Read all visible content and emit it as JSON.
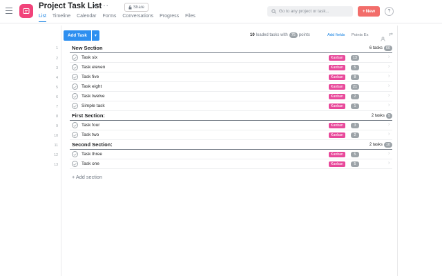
{
  "header": {
    "project_title": "Project Task List",
    "more": "···",
    "share_label": "Share",
    "tabs": [
      {
        "label": "List",
        "active": true
      },
      {
        "label": "Timeline"
      },
      {
        "label": "Calendar"
      },
      {
        "label": "Forms"
      },
      {
        "label": "Conversations"
      },
      {
        "label": "Progress"
      },
      {
        "label": "Files"
      }
    ],
    "search_placeholder": "Go to any project or task...",
    "new_label": "New",
    "help_label": "?"
  },
  "toolbar": {
    "add_task_label": "Add Task",
    "loaded_count": "10",
    "loaded_text": "loaded tasks with",
    "points_total": "75",
    "points_text": "points",
    "add_fields_label": "Add fields",
    "points_ex_label": "Points Ex"
  },
  "sections": [
    {
      "row": "1",
      "title": "New Section",
      "count_text": "6 tasks",
      "points": "60"
    },
    {
      "row": "8",
      "title": "First Section:",
      "count_text": "2 tasks",
      "points": "5"
    },
    {
      "row": "11",
      "title": "Second Section:",
      "count_text": "2 tasks",
      "points": "10"
    }
  ],
  "tasks": [
    {
      "row": "2",
      "name": "Task six",
      "tag": "Kanban",
      "points": "13"
    },
    {
      "row": "3",
      "name": "Task eleven",
      "tag": "Kanban",
      "points": "5"
    },
    {
      "row": "4",
      "name": "Task five",
      "tag": "Kanban",
      "points": "8"
    },
    {
      "row": "5",
      "name": "Task eight",
      "tag": "Kanban",
      "points": "21"
    },
    {
      "row": "6",
      "name": "Task twelve",
      "tag": "Kanban",
      "points": "2"
    },
    {
      "row": "7",
      "name": "Simple task",
      "tag": "Kanban",
      "points": "1"
    },
    {
      "row": "9",
      "name": "Task four",
      "tag": "Kanban",
      "points": "3"
    },
    {
      "row": "10",
      "name": "Task two",
      "tag": "Kanban",
      "points": "2"
    },
    {
      "row": "12",
      "name": "Task three",
      "tag": "Kanban",
      "points": "5"
    },
    {
      "row": "13",
      "name": "Task one",
      "tag": "Kanban",
      "points": "5"
    }
  ],
  "add_section_label": "+ Add section",
  "colors": {
    "accent": "#0d7ce0",
    "app_icon": "#f1437a",
    "new_button": "#f26d6a",
    "tag": "#e8489a",
    "points_badge": "#9ca3a8"
  }
}
